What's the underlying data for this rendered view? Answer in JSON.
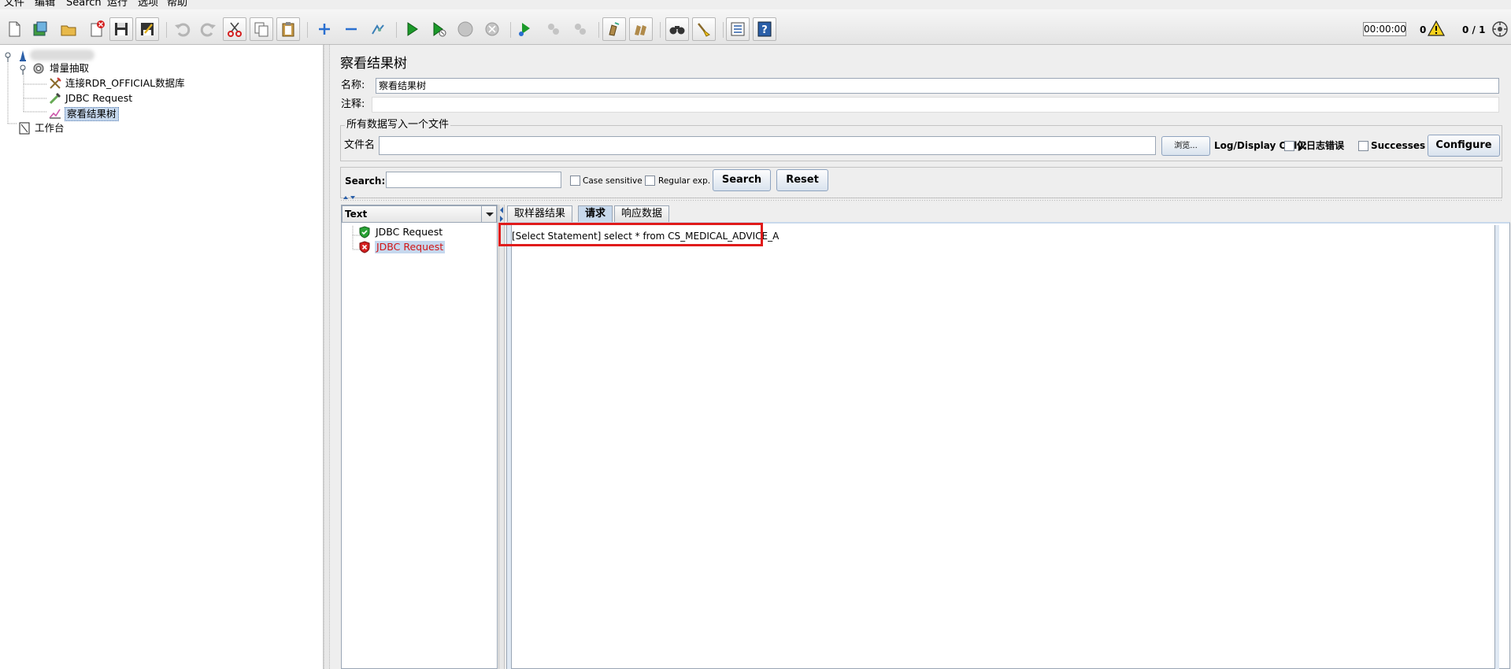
{
  "menu": [
    "文件",
    "编辑",
    "Search",
    "运行",
    "选项",
    "帮助"
  ],
  "toolbar": {
    "timer": "00:00:00",
    "warning_count": "0",
    "thread_ratio": "0 / 1",
    "icons": [
      "new-icon",
      "templates-icon",
      "open-icon",
      "close-icon",
      "save-icon",
      "save-as-icon",
      "undo-icon",
      "redo-icon",
      "cut-icon",
      "copy-icon",
      "paste-icon",
      "expand-icon",
      "collapse-icon",
      "toggle-icon",
      "start-icon",
      "start-no-pause-icon",
      "stop-icon",
      "shutdown-icon",
      "remote-start-icon",
      "remote-stop-icon",
      "remote-shutdown-icon",
      "clear-icon",
      "clear-all-icon",
      "search-icon",
      "reset-search-icon",
      "function-helper-icon",
      "help-icon"
    ]
  },
  "tree": {
    "root_label": "",
    "thread_group": "增量抽取",
    "jdbc_connection": "连接RDR_OFFICIAL数据库",
    "jdbc_request": "JDBC Request",
    "result_tree": "察看结果树",
    "workbench": "工作台"
  },
  "panel": {
    "title": "察看结果树",
    "name_label": "名称:",
    "name_value": "察看结果树",
    "comment_label": "注释:",
    "comment_value": "",
    "file_section_title": "所有数据写入一个文件",
    "filename_label": "文件名",
    "filename_value": "",
    "browse_label": "浏览...",
    "log_display_label": "Log/Display Only:",
    "errors_only_label": "仅日志错误",
    "successes_label": "Successes",
    "configure_label": "Configure"
  },
  "search": {
    "label": "Search:",
    "value": "",
    "case_sensitive_label": "Case sensitive",
    "regex_label": "Regular exp.",
    "search_button": "Search",
    "reset_button": "Reset"
  },
  "results": {
    "renderer_selected": "Text",
    "samples": [
      {
        "label": "JDBC Request",
        "status": "success"
      },
      {
        "label": "JDBC Request",
        "status": "error"
      }
    ],
    "tabs": [
      "取样器结果",
      "请求",
      "响应数据"
    ],
    "active_tab": "请求",
    "request_text": "[Select Statement] select * from CS_MEDICAL_ADVICE_A"
  },
  "colors": {
    "error_text": "#d21414",
    "highlight_box": "#e01b1b",
    "selection_bg": "#c6d8ee"
  }
}
